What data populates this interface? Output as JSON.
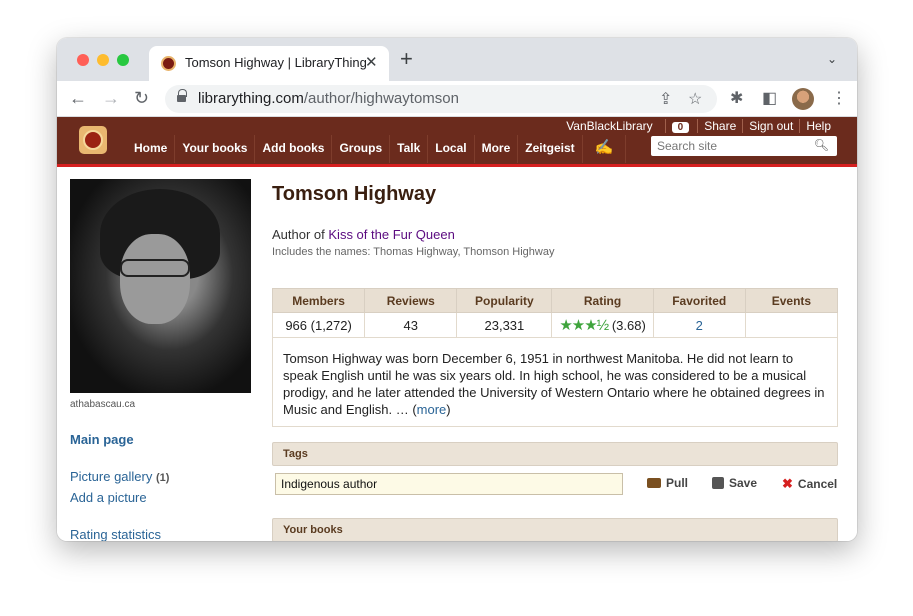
{
  "browser": {
    "tab_title": "Tomson Highway | LibraryThing",
    "tab_close": "✕",
    "new_tab": "+",
    "tab_menu": "⌄",
    "url_host": "librarything.com",
    "url_path": "/author/highwaytomson",
    "icons": [
      "back-icon",
      "forward-icon",
      "reload-icon",
      "lock-icon",
      "share-icon",
      "star-icon",
      "extensions-icon",
      "sidebar-icon",
      "profile-avatar",
      "menu-icon"
    ]
  },
  "lt": {
    "nav": [
      "Home",
      "Your books",
      "Add books",
      "Groups",
      "Talk",
      "Local",
      "More",
      "Zeitgeist"
    ],
    "top_links": {
      "user": "VanBlackLibrary",
      "badge": "0",
      "share": "Share",
      "signout": "Sign out",
      "help": "Help"
    },
    "search_placeholder": "Search site",
    "accent": "#6b2b1d",
    "stripe": "#d62020"
  },
  "sidebar": {
    "photo_caption": "athabascau.ca",
    "main_page": "Main page",
    "picture_gallery": "Picture gallery",
    "picture_gallery_count": "(1)",
    "add_picture": "Add a picture",
    "rating_statistics": "Rating statistics"
  },
  "author": {
    "name": "Tomson Highway",
    "author_of_prefix": "Author of",
    "book": "Kiss of the Fur Queen",
    "also_names": "Includes the names: Thomas Highway, Thomson Highway"
  },
  "stats": {
    "headers": [
      "Members",
      "Reviews",
      "Popularity",
      "Rating",
      "Favorited",
      "Events"
    ],
    "members": "966 (1,272)",
    "reviews": "43",
    "popularity": "23,331",
    "rating_stars": "★★★½",
    "rating_value": "(3.68)",
    "favorited": "2",
    "events": ""
  },
  "bio": {
    "text": "Tomson Highway was born December 6, 1951 in northwest Manitoba. He did not learn to speak English until he was six years old. In high school, he was considered to be a musical prodigy, and he later attended the University of Western Ontario where he obtained degrees in Music and English. … (",
    "more": "more",
    "close": ")"
  },
  "tags": {
    "header": "Tags",
    "input_value": "Indigenous author",
    "pull": "Pull",
    "save": "Save",
    "cancel": "Cancel"
  },
  "your_books": {
    "header": "Your books"
  }
}
